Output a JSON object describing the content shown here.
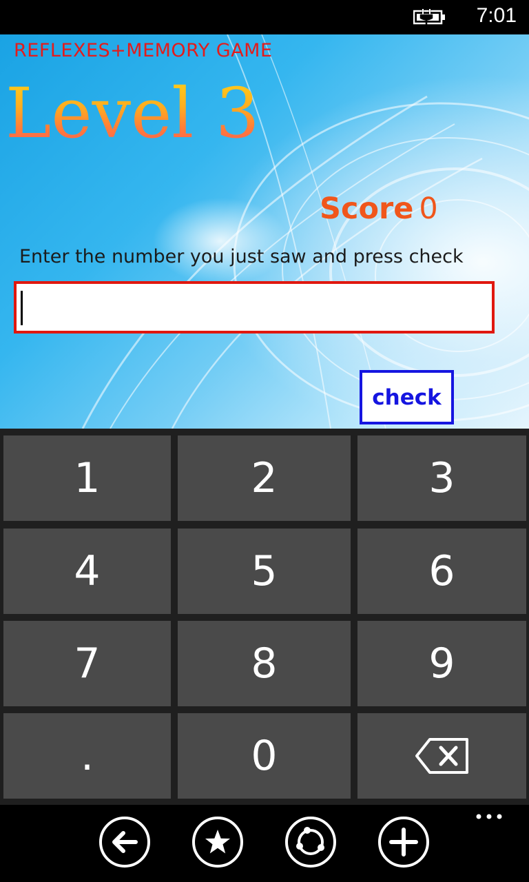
{
  "status_bar": {
    "time": "7:01",
    "battery_icon": "battery-charging-icon"
  },
  "app": {
    "title": "REFLEXES+MEMORY GAME",
    "level": "Level 3",
    "score_label": "Score",
    "score_value": "0",
    "instruction": "Enter the number you just saw and press check",
    "input_value": "",
    "check_label": "check",
    "colors": {
      "title": "#e31c1c",
      "score": "#f0561b",
      "input_border": "#e0180f",
      "check_button": "#1515e0"
    }
  },
  "keypad": {
    "keys": [
      "1",
      "2",
      "3",
      "4",
      "5",
      "6",
      "7",
      "8",
      "9",
      ".",
      "0"
    ],
    "backspace_icon": "backspace-icon"
  },
  "app_bar": {
    "buttons": [
      "back-arrow-icon",
      "star-icon",
      "share-icon",
      "add-icon"
    ],
    "more_icon": "more-dots-icon"
  }
}
